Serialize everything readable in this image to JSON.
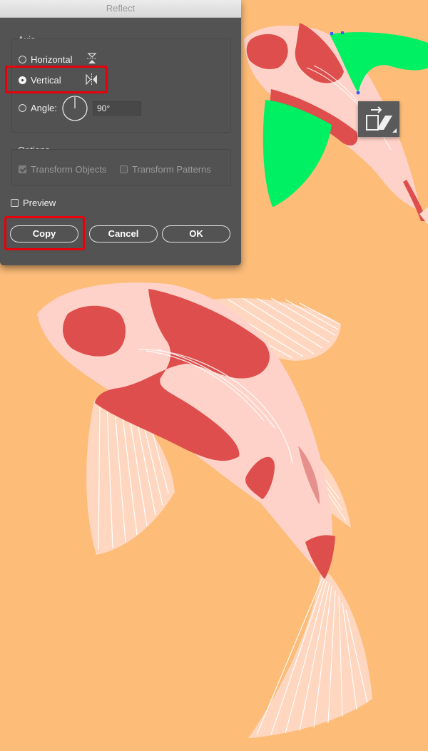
{
  "dialog": {
    "title": "Reflect",
    "axis": {
      "label": "Axis",
      "options": [
        {
          "label": "Horizontal",
          "selected": false,
          "icon": "reflect-horizontal-icon"
        },
        {
          "label": "Vertical",
          "selected": true,
          "icon": "reflect-vertical-icon"
        }
      ],
      "angle": {
        "label": "Angle:",
        "value": "90°",
        "icon": "angle-dial-icon"
      }
    },
    "options": {
      "label": "Options",
      "transform_objects": {
        "label": "Transform Objects",
        "checked": true,
        "enabled": false
      },
      "transform_patterns": {
        "label": "Transform Patterns",
        "checked": false,
        "enabled": false
      }
    },
    "preview": {
      "label": "Preview",
      "checked": false
    },
    "buttons": {
      "copy": "Copy",
      "cancel": "Cancel",
      "ok": "OK"
    }
  },
  "colors": {
    "background": "#FDBC78",
    "koi_body": "#FFD2C9",
    "koi_spot": "#DD4E4C",
    "fin": "#FFD9C8",
    "selection_green": "#00F064",
    "highlight": "#E8000A"
  },
  "floating_panel": {
    "icon": "transform-panel-icon"
  }
}
